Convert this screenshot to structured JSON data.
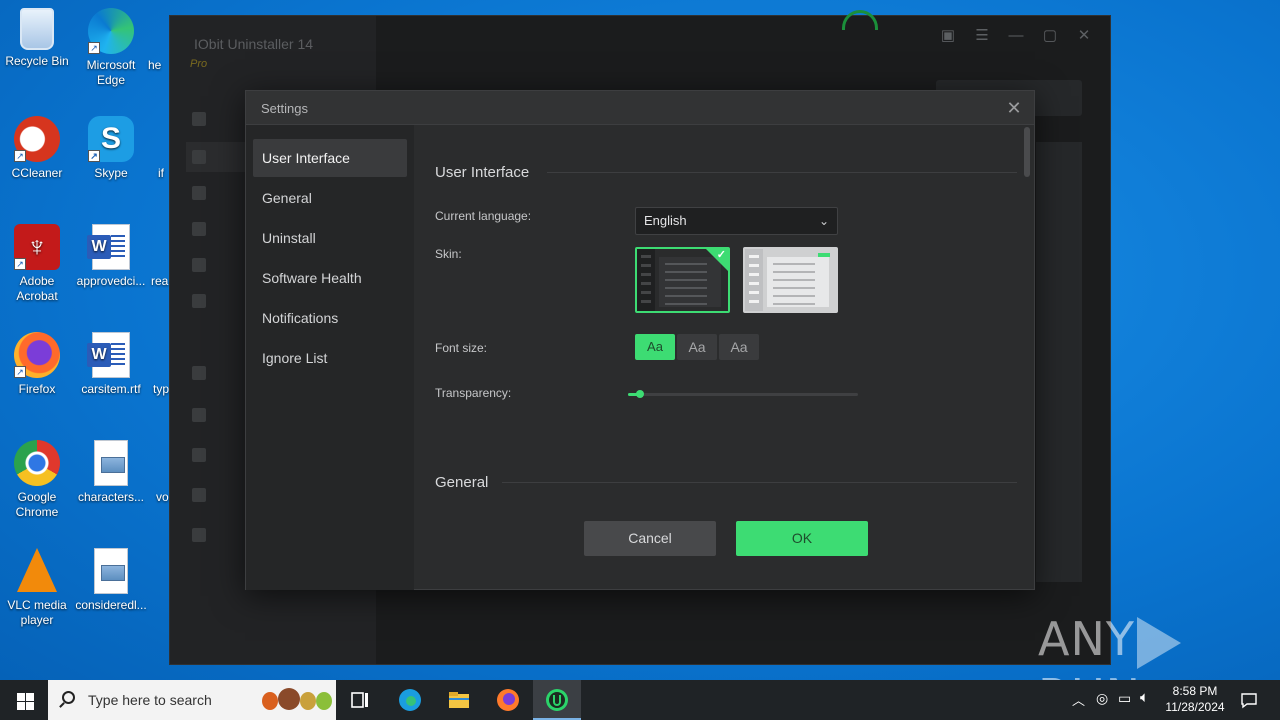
{
  "desktop": {
    "icons": [
      {
        "label": "Recycle Bin",
        "icon": "recycle-bin-icon"
      },
      {
        "label": "Microsoft Edge",
        "icon": "edge-icon"
      },
      {
        "label": "CCleaner",
        "icon": "ccleaner-icon"
      },
      {
        "label": "Skype",
        "icon": "skype-icon"
      },
      {
        "label": "Adobe Acrobat",
        "icon": "acrobat-icon"
      },
      {
        "label": "approvedci...",
        "icon": "word-document-icon"
      },
      {
        "label": "Firefox",
        "icon": "firefox-icon"
      },
      {
        "label": "carsitem.rtf",
        "icon": "word-document-icon"
      },
      {
        "label": "Google Chrome",
        "icon": "chrome-icon"
      },
      {
        "label": "characters...",
        "icon": "image-file-icon"
      },
      {
        "label": "VLC media player",
        "icon": "vlc-icon"
      },
      {
        "label": "consideredl...",
        "icon": "image-file-icon"
      }
    ],
    "partial_labels": [
      "he",
      "if",
      "rea",
      "typ",
      "vo"
    ]
  },
  "app_window": {
    "title": "IObit Uninstaller 14",
    "edition": "Pro"
  },
  "settings": {
    "title": "Settings",
    "nav": [
      {
        "label": "User Interface",
        "active": true
      },
      {
        "label": "General",
        "active": false
      },
      {
        "label": "Uninstall",
        "active": false
      },
      {
        "label": "Software Health",
        "active": false
      },
      {
        "label": "Notifications",
        "active": false
      },
      {
        "label": "Ignore List",
        "active": false
      }
    ],
    "section_user_interface": "User Interface",
    "current_language_label": "Current language:",
    "current_language_value": "English",
    "skin_label": "Skin:",
    "skin_selected": "dark",
    "font_size_label": "Font size:",
    "font_size_options": [
      "Aa",
      "Aa",
      "Aa"
    ],
    "font_size_selected_index": 0,
    "transparency_label": "Transparency:",
    "transparency_value": 0.05,
    "section_general": "General",
    "cancel_label": "Cancel",
    "ok_label": "OK",
    "accent_color": "#3ddc73"
  },
  "watermark": {
    "text_left": "ANY",
    "text_right": "RUN"
  },
  "taskbar": {
    "search_placeholder": "Type here to search",
    "apps": [
      "task-view-icon",
      "edge-icon",
      "file-explorer-icon",
      "firefox-icon",
      "iobit-uninstaller-icon"
    ],
    "clock_time": "8:58 PM",
    "clock_date": "11/28/2024"
  }
}
